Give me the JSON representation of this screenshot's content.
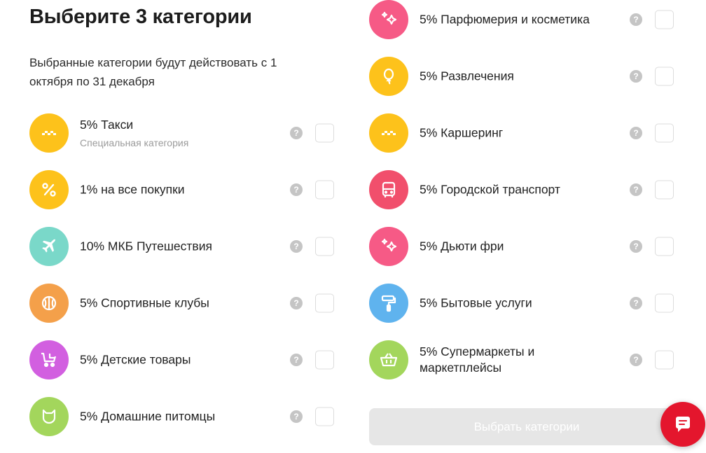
{
  "header": {
    "title": "Выберите 3 категории",
    "subtitle": "Выбранные категории будут действовать с 1 октября по 31 декабря"
  },
  "help_glyph": "?",
  "colors": {
    "yellow": "#fdc21b",
    "teal": "#7ad8c9",
    "orange": "#f4a04a",
    "purple": "#d25fe0",
    "green": "#a3d65c",
    "pink": "#f65a86",
    "red_pink": "#f14f6c",
    "blue": "#5fb3ee",
    "accent_red": "#e4162d"
  },
  "left_categories": [
    {
      "label": "5% Такси",
      "sub": "Специальная категория",
      "icon": "taxi-icon",
      "color": "#fdc21b"
    },
    {
      "label": "1% на все покупки",
      "icon": "percent-icon",
      "color": "#fdc21b"
    },
    {
      "label": "10% МКБ Путешествия",
      "icon": "airplane-icon",
      "color": "#7ad8c9"
    },
    {
      "label": "5% Спортивные клубы",
      "icon": "ball-icon",
      "color": "#f4a04a"
    },
    {
      "label": "5% Детские товары",
      "icon": "stroller-icon",
      "color": "#d25fe0"
    },
    {
      "label": "5% Домашние питомцы",
      "icon": "cat-icon",
      "color": "#a3d65c"
    }
  ],
  "right_categories": [
    {
      "label": "5% Парфюмерия и косметика",
      "icon": "sparkle-icon",
      "color": "#f65a86"
    },
    {
      "label": "5% Развлечения",
      "icon": "balloon-icon",
      "color": "#fdc21b"
    },
    {
      "label": "5% Каршеринг",
      "icon": "taxi-icon",
      "color": "#fdc21b"
    },
    {
      "label": "5% Городской транспорт",
      "icon": "bus-icon",
      "color": "#f14f6c"
    },
    {
      "label": "5% Дьюти фри",
      "icon": "sparkle-icon",
      "color": "#f65a86"
    },
    {
      "label": "5% Бытовые услуги",
      "icon": "paint-roller-icon",
      "color": "#5fb3ee"
    },
    {
      "label": "5% Супермаркеты и маркетплейсы",
      "icon": "basket-icon",
      "color": "#a3d65c"
    }
  ],
  "action": {
    "button_label": "Выбрать категории"
  }
}
